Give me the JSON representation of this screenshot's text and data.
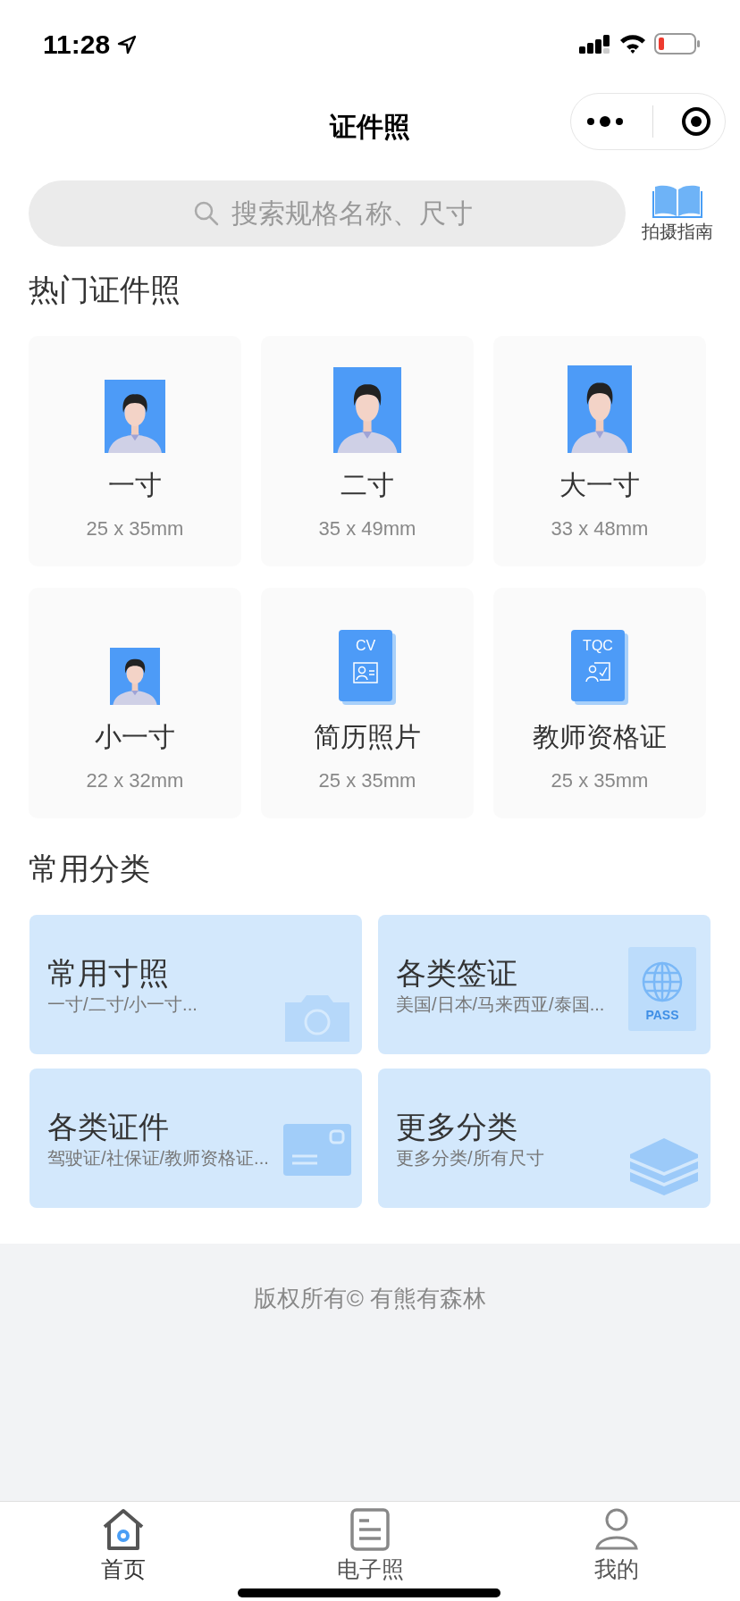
{
  "status_bar": {
    "time": "11:28"
  },
  "nav": {
    "title": "证件照"
  },
  "search": {
    "placeholder": "搜索规格名称、尺寸"
  },
  "guide": {
    "label": "拍摄指南"
  },
  "hot": {
    "title": "热门证件照",
    "items": [
      {
        "kind": "portrait",
        "name": "一寸",
        "size": "25 x 35mm"
      },
      {
        "kind": "portrait",
        "name": "二寸",
        "size": "35 x 49mm"
      },
      {
        "kind": "portrait",
        "name": "大一寸",
        "size": "33 x 48mm"
      },
      {
        "kind": "portrait",
        "name": "小一寸",
        "size": "22 x 32mm"
      },
      {
        "kind": "cv",
        "badge": "CV",
        "name": "简历照片",
        "size": "25 x 35mm"
      },
      {
        "kind": "tqc",
        "badge": "TQC",
        "name": "教师资格证",
        "size": "25 x 35mm"
      }
    ]
  },
  "categories": {
    "title": "常用分类",
    "items": [
      {
        "kind": "camera",
        "name": "常用寸照",
        "desc": "一寸/二寸/小一寸..."
      },
      {
        "kind": "passport",
        "name": "各类签证",
        "desc": "美国/日本/马来西亚/泰国...",
        "icon_text": "PASS"
      },
      {
        "kind": "card",
        "name": "各类证件",
        "desc": "驾驶证/社保证/教师资格证..."
      },
      {
        "kind": "layers",
        "name": "更多分类",
        "desc": "更多分类/所有尺寸"
      }
    ]
  },
  "footer": {
    "text": "版权所有© 有熊有森林"
  },
  "tabs": [
    {
      "kind": "home",
      "label": "首页",
      "selected": true
    },
    {
      "kind": "doc",
      "label": "电子照",
      "selected": false
    },
    {
      "kind": "user",
      "label": "我的",
      "selected": false
    }
  ]
}
